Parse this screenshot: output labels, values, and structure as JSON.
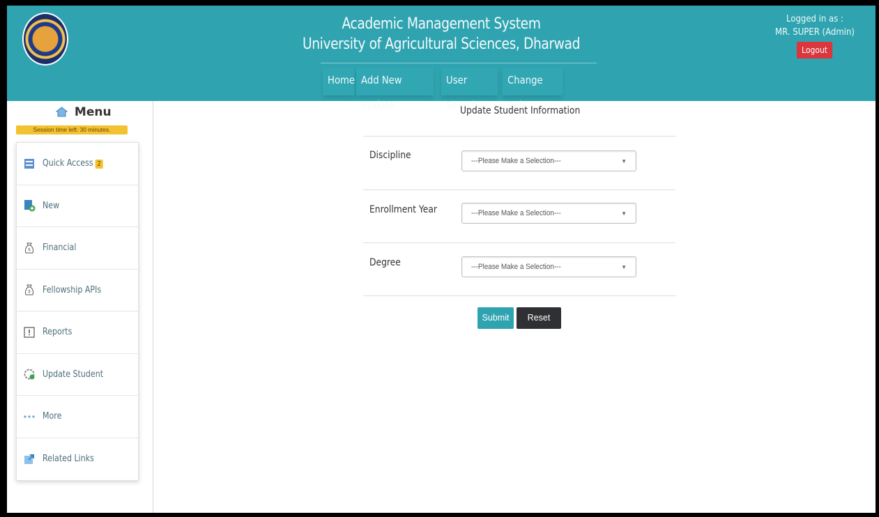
{
  "header": {
    "title": "Academic Management System",
    "subtitle": "University of Agricultural Sciences, Dharwad",
    "nav": [
      {
        "label": "Home"
      },
      {
        "label": "Add New Update"
      },
      {
        "label": "User Search"
      },
      {
        "label": "Change Role"
      }
    ],
    "login_label": "Logged in as :",
    "user": "MR. SUPER (Admin)",
    "logout_label": "Logout"
  },
  "sidebar": {
    "menu_title": "Menu",
    "session_text": "Session time left: 30 minutes.",
    "items": [
      {
        "label": "Quick Access",
        "badge": "2",
        "icon": "quick-access-icon"
      },
      {
        "label": "New",
        "icon": "new-document-icon"
      },
      {
        "label": "Financial",
        "icon": "money-bag-icon"
      },
      {
        "label": "Fellowship APIs",
        "icon": "money-bag-icon"
      },
      {
        "label": "Reports",
        "icon": "report-icon"
      },
      {
        "label": "Update Student",
        "icon": "update-student-icon"
      },
      {
        "label": "More",
        "icon": "ellipsis-icon"
      },
      {
        "label": "Related Links",
        "icon": "external-link-icon"
      }
    ]
  },
  "form": {
    "title": "Update Student Information",
    "fields": [
      {
        "label": "Discipline",
        "value": "---Please Make a Selection---"
      },
      {
        "label": "Enrollment Year",
        "value": "---Please Make a Selection---"
      },
      {
        "label": "Degree",
        "value": "---Please Make a Selection---"
      }
    ],
    "submit_label": "Submit",
    "reset_label": "Reset"
  },
  "colors": {
    "header_bg": "#2fa4b0",
    "logout_bg": "#d9363e",
    "badge_bg": "#f2c230",
    "reset_bg": "#2e3033"
  }
}
